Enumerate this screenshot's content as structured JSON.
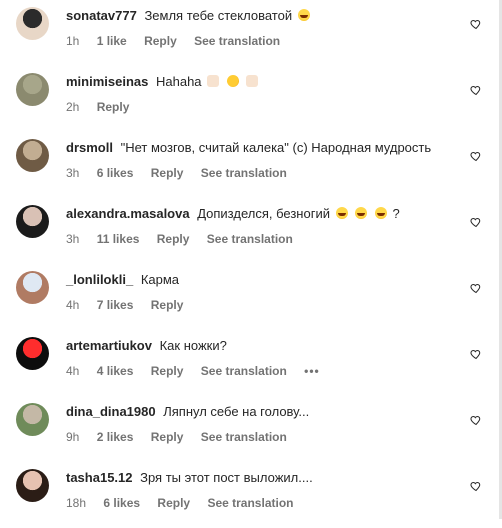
{
  "comments": [
    {
      "username": "sonatav777",
      "text": "Земля тебе стекловатой",
      "emojis": [
        "laugh"
      ],
      "time": "1h",
      "likes": "1 like",
      "reply": "Reply",
      "translate": "See translation",
      "more": "",
      "avatar_colors": [
        "#e8d7c7",
        "#2b2b2b"
      ]
    },
    {
      "username": "minimiseinas",
      "text": "Hahaha",
      "emojis": [
        "skin",
        "tilt",
        "skin"
      ],
      "time": "2h",
      "likes": "",
      "reply": "Reply",
      "translate": "",
      "more": "",
      "avatar_colors": [
        "#8b8a6f",
        "#a7a68a"
      ]
    },
    {
      "username": "drsmoll",
      "text": "\"Нет мозгов, считай калека\" (с) Народная мудрость",
      "emojis": [],
      "time": "3h",
      "likes": "6 likes",
      "reply": "Reply",
      "translate": "See translation",
      "more": "",
      "avatar_colors": [
        "#6f5b45",
        "#c2ad92"
      ]
    },
    {
      "username": "alexandra.masalova",
      "text": "Допизделся, безногий",
      "emojis": [
        "laugh",
        "laugh",
        "laugh"
      ],
      "suffix": "?",
      "time": "3h",
      "likes": "11 likes",
      "reply": "Reply",
      "translate": "See translation",
      "more": "",
      "avatar_colors": [
        "#1b1b1b",
        "#d9c1b5"
      ]
    },
    {
      "username": "_lonlilokli_",
      "text": "Карма",
      "emojis": [],
      "time": "4h",
      "likes": "7 likes",
      "reply": "Reply",
      "translate": "",
      "more": "",
      "avatar_colors": [
        "#b07b63",
        "#dfe8f3"
      ]
    },
    {
      "username": "artemartiukov",
      "text": "Как ножки?",
      "emojis": [],
      "time": "4h",
      "likes": "4 likes",
      "reply": "Reply",
      "translate": "See translation",
      "more": "•••",
      "avatar_colors": [
        "#0d0d0d",
        "#ff2d2d"
      ]
    },
    {
      "username": "dina_dina1980",
      "text": "Ляпнул себе на голову...",
      "emojis": [],
      "time": "9h",
      "likes": "2 likes",
      "reply": "Reply",
      "translate": "See translation",
      "more": "",
      "avatar_colors": [
        "#6f8b5a",
        "#c4b8a6"
      ]
    },
    {
      "username": "tasha15.12",
      "text": "Зря ты этот пост выложил....",
      "emojis": [],
      "time": "18h",
      "likes": "6 likes",
      "reply": "Reply",
      "translate": "See translation",
      "more": "",
      "avatar_colors": [
        "#2b1d16",
        "#e6c2b1"
      ]
    }
  ],
  "icons": {
    "heart": "heart-icon"
  }
}
